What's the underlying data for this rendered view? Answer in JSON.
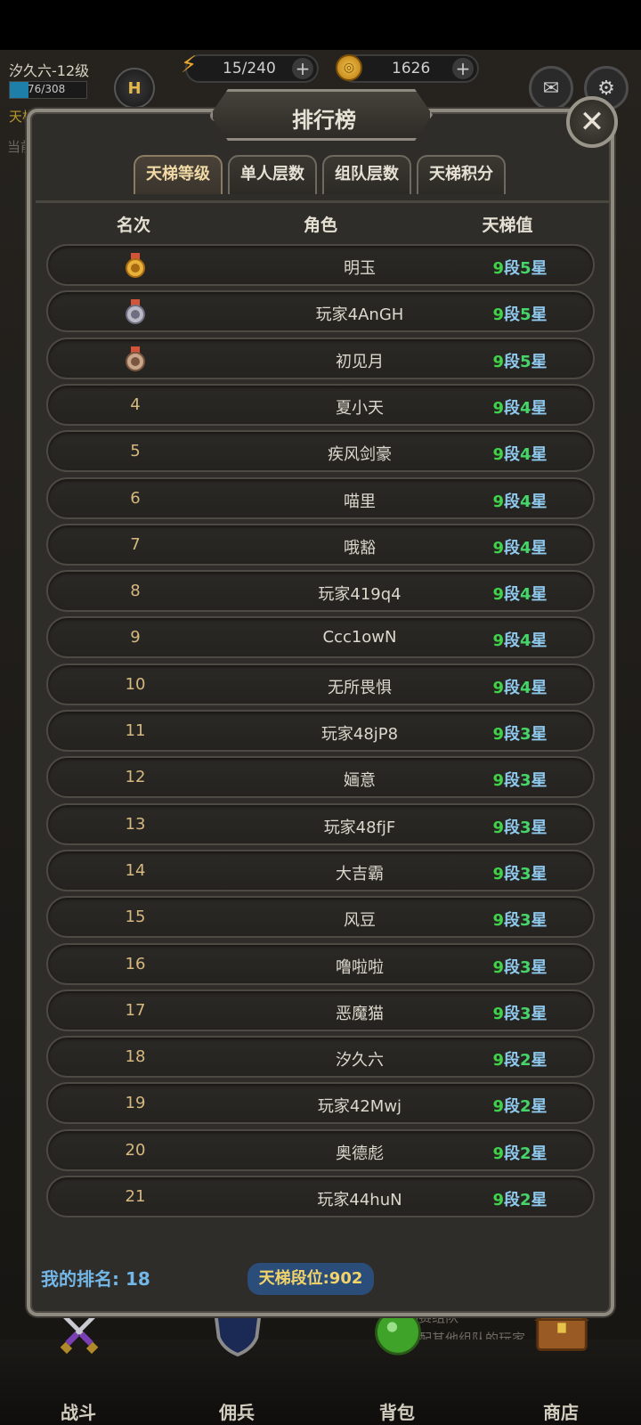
{
  "hud": {
    "player_name": "汐久六-12级",
    "xp_text": "76/308",
    "xp_fraction": 0.247,
    "rank_badge": "H",
    "stamina": "15/240",
    "gold": "1626",
    "plus": "+",
    "side_label_1": "天梯",
    "side_label_2": "当前"
  },
  "dialog": {
    "title": "排行榜",
    "close_symbol": "✕",
    "tabs": [
      {
        "label": "天梯等级",
        "active": true
      },
      {
        "label": "单人层数",
        "active": false
      },
      {
        "label": "组队层数",
        "active": false
      },
      {
        "label": "天梯积分",
        "active": false
      }
    ],
    "columns": {
      "rank": "名次",
      "role": "角色",
      "score": "天梯值"
    },
    "rows": [
      {
        "rank": "",
        "medal": "gold",
        "name": "明玉",
        "dan": "9",
        "star": "5"
      },
      {
        "rank": "",
        "medal": "silver",
        "name": "玩家4AnGH",
        "dan": "9",
        "star": "5"
      },
      {
        "rank": "",
        "medal": "bronze",
        "name": "初见月",
        "dan": "9",
        "star": "5"
      },
      {
        "rank": "4",
        "name": "夏小天",
        "dan": "9",
        "star": "4"
      },
      {
        "rank": "5",
        "name": "疾风剑豪",
        "dan": "9",
        "star": "4"
      },
      {
        "rank": "6",
        "name": "喵里",
        "dan": "9",
        "star": "4"
      },
      {
        "rank": "7",
        "name": "哦豁",
        "dan": "9",
        "star": "4"
      },
      {
        "rank": "8",
        "name": "玩家419q4",
        "dan": "9",
        "star": "4"
      },
      {
        "rank": "9",
        "name": "Ccc1owN",
        "dan": "9",
        "star": "4"
      },
      {
        "rank": "10",
        "name": "无所畏惧",
        "dan": "9",
        "star": "4"
      },
      {
        "rank": "11",
        "name": "玩家48jP8",
        "dan": "9",
        "star": "3"
      },
      {
        "rank": "12",
        "name": "婳意",
        "dan": "9",
        "star": "3"
      },
      {
        "rank": "13",
        "name": "玩家48fjF",
        "dan": "9",
        "star": "3"
      },
      {
        "rank": "14",
        "name": "大吉霸",
        "dan": "9",
        "star": "3"
      },
      {
        "rank": "15",
        "name": "风豆",
        "dan": "9",
        "star": "3"
      },
      {
        "rank": "16",
        "name": "噜啦啦",
        "dan": "9",
        "star": "3"
      },
      {
        "rank": "17",
        "name": "恶魔猫",
        "dan": "9",
        "star": "3"
      },
      {
        "rank": "18",
        "name": "汐久六",
        "dan": "9",
        "star": "2"
      },
      {
        "rank": "19",
        "name": "玩家42Mwj",
        "dan": "9",
        "star": "2"
      },
      {
        "rank": "20",
        "name": "奥德彪",
        "dan": "9",
        "star": "2"
      },
      {
        "rank": "21",
        "name": "玩家44huN",
        "dan": "9",
        "star": "2"
      }
    ],
    "dan_unit": "段",
    "star_unit": "星",
    "my_rank": "我的排名: 18",
    "ladder_position": "天梯段位:902"
  },
  "hint_lines": [
    "天梯赛组队",
    "可匹配其他组队的玩家"
  ],
  "nav": [
    {
      "label": "战斗",
      "icon": "crossed-swords-icon"
    },
    {
      "label": "佣兵",
      "icon": "shield-icon"
    },
    {
      "label": "背包",
      "icon": "potion-icon"
    },
    {
      "label": "商店",
      "icon": "chest-icon"
    }
  ],
  "colors": {
    "green_number": "#3fd24a",
    "blue_unit": "#8fc9ee",
    "gold_text": "#d6b880"
  }
}
